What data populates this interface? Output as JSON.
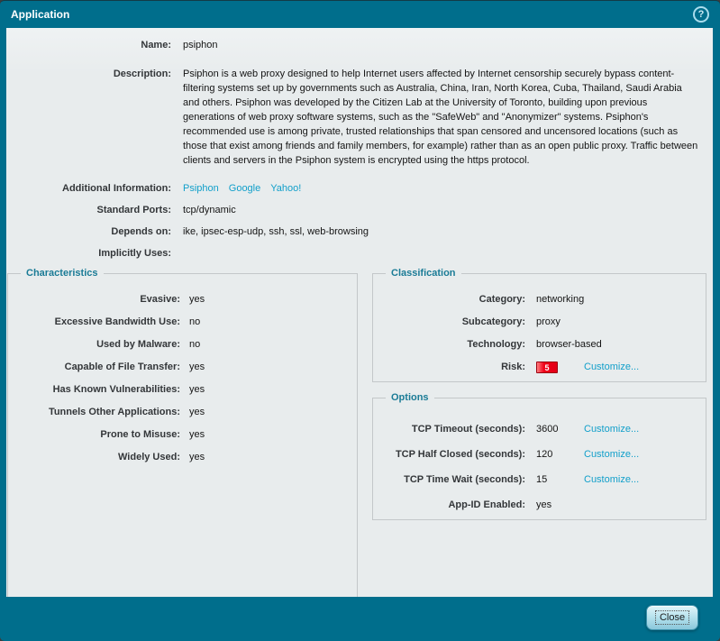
{
  "dialog": {
    "title": "Application",
    "close_label": "Close"
  },
  "icons": {
    "help_glyph": "?"
  },
  "colors": {
    "teal": "#006e8c",
    "link_blue": "#119fca",
    "risk_red": "#e30017",
    "legend_teal": "#1a7b96"
  },
  "general": {
    "rows": [
      {
        "label": "Name:",
        "value": "psiphon"
      },
      {
        "label": "Description:",
        "value": "Psiphon is a web proxy designed to help Internet users affected by Internet censorship securely bypass content-filtering systems set up by governments such as Australia, China, Iran, North Korea, Cuba, Thailand, Saudi Arabia and others. Psiphon was developed by the Citizen Lab at the University of Toronto, building upon previous generations of web proxy software systems, such as the \"SafeWeb\" and \"Anonymizer\" systems. Psiphon's recommended use is among private, trusted relationships that span censored and uncensored locations (such as those that exist among friends and family members, for example) rather than as an open public proxy. Traffic between clients and servers in the Psiphon system is encrypted using the https protocol."
      },
      {
        "label": "Additional Information:",
        "links": [
          "Psiphon",
          "Google",
          "Yahoo!"
        ]
      },
      {
        "label": "Standard Ports:",
        "value": "tcp/dynamic"
      },
      {
        "label": "Depends on:",
        "value": "ike, ipsec-esp-udp, ssh, ssl, web-browsing"
      },
      {
        "label": "Implicitly Uses:",
        "value": ""
      }
    ]
  },
  "characteristics": {
    "legend": "Characteristics",
    "rows": [
      {
        "label": "Evasive:",
        "value": "yes"
      },
      {
        "label": "Excessive Bandwidth Use:",
        "value": "no"
      },
      {
        "label": "Used by Malware:",
        "value": "no"
      },
      {
        "label": "Capable of File Transfer:",
        "value": "yes"
      },
      {
        "label": "Has Known Vulnerabilities:",
        "value": "yes"
      },
      {
        "label": "Tunnels Other Applications:",
        "value": "yes"
      },
      {
        "label": "Prone to Misuse:",
        "value": "yes"
      },
      {
        "label": "Widely Used:",
        "value": "yes"
      }
    ]
  },
  "classification": {
    "legend": "Classification",
    "rows": [
      {
        "label": "Category:",
        "value": "networking"
      },
      {
        "label": "Subcategory:",
        "value": "proxy"
      },
      {
        "label": "Technology:",
        "value": "browser-based"
      },
      {
        "label": "Risk:",
        "value": "5",
        "link": "Customize..."
      }
    ]
  },
  "options": {
    "legend": "Options",
    "rows": [
      {
        "label": "TCP Timeout (seconds):",
        "value": "3600",
        "link": "Customize..."
      },
      {
        "label": "TCP Half Closed (seconds):",
        "value": "120",
        "link": "Customize..."
      },
      {
        "label": "TCP Time Wait (seconds):",
        "value": "15",
        "link": "Customize..."
      },
      {
        "label": "App-ID Enabled:",
        "value": "yes"
      }
    ]
  }
}
